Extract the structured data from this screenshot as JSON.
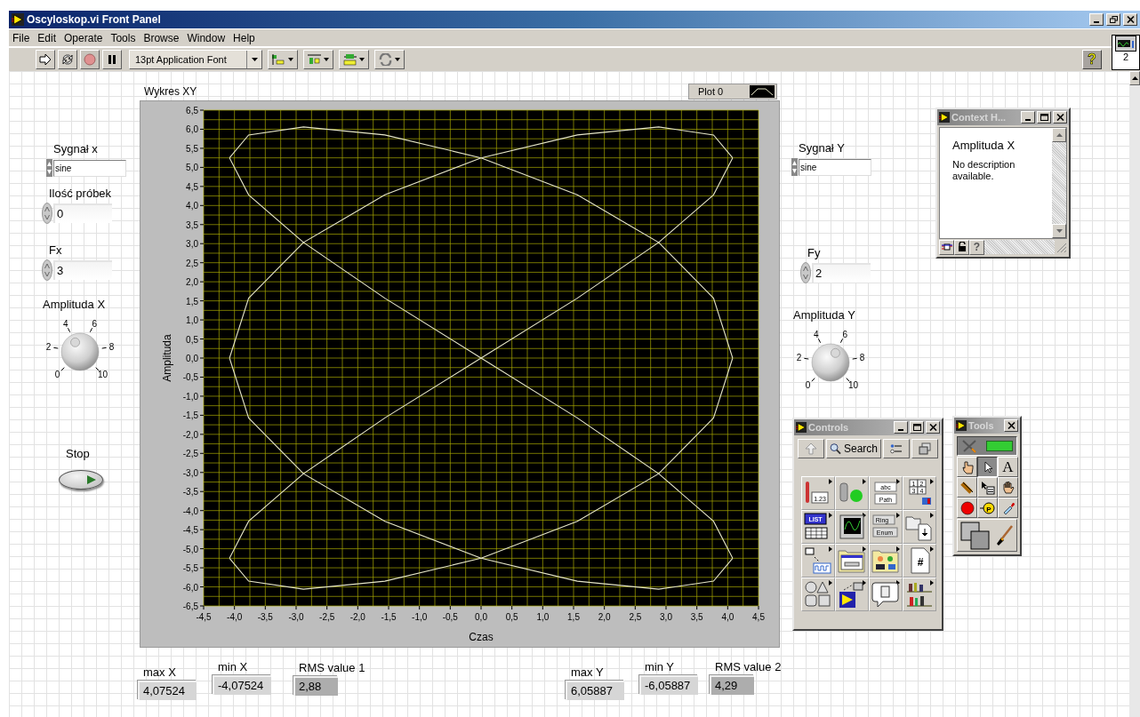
{
  "window": {
    "title": "Oscyloskop.vi Front Panel"
  },
  "menu": [
    "File",
    "Edit",
    "Operate",
    "Tools",
    "Browse",
    "Window",
    "Help"
  ],
  "toolbar": {
    "font": "13pt Application Font",
    "help": "?",
    "vi_icon_number": "2"
  },
  "panel": {
    "graph": {
      "chart_data": {
        "type": "line",
        "grid": true,
        "title": "Wykres XY",
        "xlabel": "Czas",
        "ylabel": "Amplituda",
        "xlim": [
          -4.5,
          4.5
        ],
        "ylim": [
          -6.5,
          6.5
        ],
        "xticks": [
          {
            "value": -4.5,
            "label": "-4,5"
          },
          {
            "value": -4,
            "label": "-4,0"
          },
          {
            "value": -3.5,
            "label": "-3,5"
          },
          {
            "value": -3,
            "label": "-3,0"
          },
          {
            "value": -2.5,
            "label": "-2,5"
          },
          {
            "value": -2,
            "label": "-2,0"
          },
          {
            "value": -1.5,
            "label": "-1,5"
          },
          {
            "value": -1,
            "label": "-1,0"
          },
          {
            "value": -0.5,
            "label": "-0,5"
          },
          {
            "value": 0,
            "label": "0,0"
          },
          {
            "value": 0.5,
            "label": "0,5"
          },
          {
            "value": 1,
            "label": "1,0"
          },
          {
            "value": 1.5,
            "label": "1,5"
          },
          {
            "value": 2,
            "label": "2,0"
          },
          {
            "value": 2.5,
            "label": "2,5"
          },
          {
            "value": 3,
            "label": "3,0"
          },
          {
            "value": 3.5,
            "label": "3,5"
          },
          {
            "value": 4,
            "label": "4,0"
          },
          {
            "value": 4.5,
            "label": "4,5"
          }
        ],
        "yticks": [
          {
            "value": 6.5,
            "label": "6,5"
          },
          {
            "value": 6,
            "label": "6,0"
          },
          {
            "value": 5.5,
            "label": "5,5"
          },
          {
            "value": 5,
            "label": "5,0"
          },
          {
            "value": 4.5,
            "label": "4,5"
          },
          {
            "value": 4,
            "label": "4,0"
          },
          {
            "value": 3.5,
            "label": "3,5"
          },
          {
            "value": 3,
            "label": "3,0"
          },
          {
            "value": 2.5,
            "label": "2,5"
          },
          {
            "value": 2,
            "label": "2,0"
          },
          {
            "value": 1.5,
            "label": "1,5"
          },
          {
            "value": 1,
            "label": "1,0"
          },
          {
            "value": 0.5,
            "label": "0,5"
          },
          {
            "value": 0,
            "label": "0,0"
          },
          {
            "value": -0.5,
            "label": "-0,5"
          },
          {
            "value": -1,
            "label": "-1,0"
          },
          {
            "value": -1.5,
            "label": "-1,5"
          },
          {
            "value": -2,
            "label": "-2,0"
          },
          {
            "value": -2.5,
            "label": "-2,5"
          },
          {
            "value": -3,
            "label": "-3,0"
          },
          {
            "value": -3.5,
            "label": "-3,5"
          },
          {
            "value": -4,
            "label": "-4,0"
          },
          {
            "value": -4.5,
            "label": "-4,5"
          },
          {
            "value": -5,
            "label": "-5,0"
          },
          {
            "value": -5.5,
            "label": "-5,5"
          },
          {
            "value": -6,
            "label": "-6,0"
          },
          {
            "value": -6.5,
            "label": "-6,5"
          }
        ],
        "x": [
          4.08,
          3.77,
          2.88,
          1.56,
          0,
          -1.56,
          -2.88,
          -3.77,
          -4.08,
          -3.77,
          -2.88,
          -1.56,
          0,
          1.56,
          2.88,
          3.77,
          4.08,
          3.77,
          2.88,
          1.56,
          0,
          -1.56,
          -2.88,
          -3.77,
          -4.08,
          -3.77,
          -2.88,
          -1.56,
          0,
          1.56,
          2.88,
          3.77,
          4.08,
          3.77,
          2.88,
          1.56,
          0,
          -1.56,
          -2.88,
          -3.77,
          -4.08,
          -3.77,
          -2.88,
          -1.56,
          0,
          1.56,
          2.88,
          3.77,
          4.08
        ],
        "series": [
          {
            "name": "Plot 0",
            "color": "#e6e6c8",
            "values": [
              0,
              1.57,
              3.03,
              4.28,
              5.25,
              5.85,
              6.06,
              5.85,
              5.25,
              4.28,
              3.03,
              1.57,
              0,
              -1.57,
              -3.03,
              -4.28,
              -5.25,
              -5.85,
              -6.06,
              -5.85,
              -5.25,
              -4.28,
              -3.03,
              -1.57,
              0,
              1.57,
              3.03,
              4.28,
              5.25,
              5.85,
              6.06,
              5.85,
              5.25,
              4.28,
              3.03,
              1.57,
              0,
              -1.57,
              -3.03,
              -4.28,
              -5.25,
              -5.85,
              -6.06,
              -5.85,
              -5.25,
              -4.28,
              -3.03,
              -1.57,
              0
            ]
          }
        ]
      }
    },
    "controls": [
      {
        "kind": "ring",
        "label": "Sygnał x",
        "value": "sine"
      },
      {
        "kind": "numeric",
        "label": "Ilość próbek",
        "value": "0"
      },
      {
        "kind": "numeric",
        "label": "Fx",
        "value": "3"
      },
      {
        "kind": "knob",
        "label": "Amplituda X",
        "level": 0.4,
        "scale": [
          "0",
          "2",
          "4",
          "6",
          "8",
          "10"
        ]
      },
      {
        "kind": "button",
        "label": "Stop"
      },
      {
        "kind": "ring",
        "label": "Sygnał Y",
        "value": "sine"
      },
      {
        "kind": "numeric",
        "label": "Fy",
        "value": "2"
      },
      {
        "kind": "knob",
        "label": "Amplituda Y",
        "level": 0.6,
        "scale": [
          "0",
          "2",
          "4",
          "6",
          "8",
          "10"
        ]
      }
    ],
    "indicators": [
      {
        "kind": "plain",
        "label": "max X",
        "value": "4,07524"
      },
      {
        "kind": "plain",
        "label": "min X",
        "value": "-4,07524"
      },
      {
        "kind": "shaded",
        "label": "RMS value 1",
        "value": "2,88"
      },
      {
        "kind": "plain",
        "label": "max Y",
        "value": "6,05887"
      },
      {
        "kind": "plain",
        "label": "min Y",
        "value": "-6,05887"
      },
      {
        "kind": "shaded",
        "label": "RMS value 2",
        "value": "4,29"
      }
    ]
  },
  "context_help": {
    "title": "Context H...",
    "heading": "Amplituda X",
    "text": "No description available.",
    "help": "?"
  },
  "controls_palette": {
    "title": "Controls",
    "search": "Search",
    "tiles": [
      {
        "kind": "numeric",
        "texts": [
          "1.23"
        ]
      },
      {
        "kind": "boolean"
      },
      {
        "kind": "string",
        "texts": [
          "abc",
          "Path"
        ]
      },
      {
        "kind": "array",
        "texts": [
          "1",
          "2",
          "3",
          "4"
        ]
      },
      {
        "kind": "list",
        "texts": [
          "LIST"
        ]
      },
      {
        "kind": "graph"
      },
      {
        "kind": "ring",
        "texts": [
          "Ring",
          "Enum"
        ]
      },
      {
        "kind": "io"
      },
      {
        "kind": "signal"
      },
      {
        "kind": "container"
      },
      {
        "kind": "decoration"
      },
      {
        "kind": "refnum",
        "texts": [
          "#"
        ]
      },
      {
        "kind": "shapes"
      },
      {
        "kind": "vi"
      },
      {
        "kind": "dialog"
      },
      {
        "kind": "library"
      }
    ]
  },
  "tools_palette": {
    "title": "Tools",
    "tools": [
      {
        "kind": "operate",
        "selected": false
      },
      {
        "kind": "position",
        "selected": true
      },
      {
        "kind": "text",
        "label": "A",
        "selected": false
      },
      {
        "kind": "wire",
        "selected": false
      },
      {
        "kind": "shortcut",
        "selected": false
      },
      {
        "kind": "scroll",
        "selected": false
      },
      {
        "kind": "breakpoint",
        "selected": false
      },
      {
        "kind": "probe",
        "label": "P",
        "selected": false
      },
      {
        "kind": "color-copy",
        "selected": false
      }
    ]
  }
}
